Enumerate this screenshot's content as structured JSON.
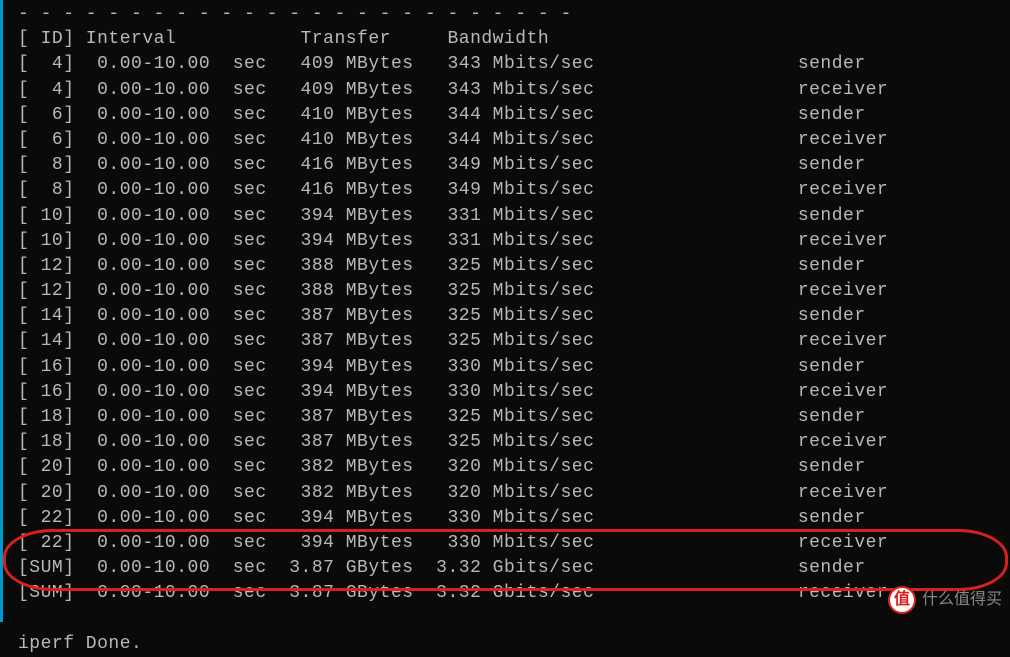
{
  "header": {
    "dashes": "- - - - - - - - - - - - - - - - - - - - - - - - -",
    "columns": "[ ID] Interval           Transfer     Bandwidth"
  },
  "rows": [
    {
      "id": "  4",
      "interval": "0.00-10.00",
      "unit": "sec",
      "transfer": " 409 MBytes",
      "bandwidth": " 343 Mbits/sec",
      "role": "sender"
    },
    {
      "id": "  4",
      "interval": "0.00-10.00",
      "unit": "sec",
      "transfer": " 409 MBytes",
      "bandwidth": " 343 Mbits/sec",
      "role": "receiver"
    },
    {
      "id": "  6",
      "interval": "0.00-10.00",
      "unit": "sec",
      "transfer": " 410 MBytes",
      "bandwidth": " 344 Mbits/sec",
      "role": "sender"
    },
    {
      "id": "  6",
      "interval": "0.00-10.00",
      "unit": "sec",
      "transfer": " 410 MBytes",
      "bandwidth": " 344 Mbits/sec",
      "role": "receiver"
    },
    {
      "id": "  8",
      "interval": "0.00-10.00",
      "unit": "sec",
      "transfer": " 416 MBytes",
      "bandwidth": " 349 Mbits/sec",
      "role": "sender"
    },
    {
      "id": "  8",
      "interval": "0.00-10.00",
      "unit": "sec",
      "transfer": " 416 MBytes",
      "bandwidth": " 349 Mbits/sec",
      "role": "receiver"
    },
    {
      "id": " 10",
      "interval": "0.00-10.00",
      "unit": "sec",
      "transfer": " 394 MBytes",
      "bandwidth": " 331 Mbits/sec",
      "role": "sender"
    },
    {
      "id": " 10",
      "interval": "0.00-10.00",
      "unit": "sec",
      "transfer": " 394 MBytes",
      "bandwidth": " 331 Mbits/sec",
      "role": "receiver"
    },
    {
      "id": " 12",
      "interval": "0.00-10.00",
      "unit": "sec",
      "transfer": " 388 MBytes",
      "bandwidth": " 325 Mbits/sec",
      "role": "sender"
    },
    {
      "id": " 12",
      "interval": "0.00-10.00",
      "unit": "sec",
      "transfer": " 388 MBytes",
      "bandwidth": " 325 Mbits/sec",
      "role": "receiver"
    },
    {
      "id": " 14",
      "interval": "0.00-10.00",
      "unit": "sec",
      "transfer": " 387 MBytes",
      "bandwidth": " 325 Mbits/sec",
      "role": "sender"
    },
    {
      "id": " 14",
      "interval": "0.00-10.00",
      "unit": "sec",
      "transfer": " 387 MBytes",
      "bandwidth": " 325 Mbits/sec",
      "role": "receiver"
    },
    {
      "id": " 16",
      "interval": "0.00-10.00",
      "unit": "sec",
      "transfer": " 394 MBytes",
      "bandwidth": " 330 Mbits/sec",
      "role": "sender"
    },
    {
      "id": " 16",
      "interval": "0.00-10.00",
      "unit": "sec",
      "transfer": " 394 MBytes",
      "bandwidth": " 330 Mbits/sec",
      "role": "receiver"
    },
    {
      "id": " 18",
      "interval": "0.00-10.00",
      "unit": "sec",
      "transfer": " 387 MBytes",
      "bandwidth": " 325 Mbits/sec",
      "role": "sender"
    },
    {
      "id": " 18",
      "interval": "0.00-10.00",
      "unit": "sec",
      "transfer": " 387 MBytes",
      "bandwidth": " 325 Mbits/sec",
      "role": "receiver"
    },
    {
      "id": " 20",
      "interval": "0.00-10.00",
      "unit": "sec",
      "transfer": " 382 MBytes",
      "bandwidth": " 320 Mbits/sec",
      "role": "sender"
    },
    {
      "id": " 20",
      "interval": "0.00-10.00",
      "unit": "sec",
      "transfer": " 382 MBytes",
      "bandwidth": " 320 Mbits/sec",
      "role": "receiver"
    },
    {
      "id": " 22",
      "interval": "0.00-10.00",
      "unit": "sec",
      "transfer": " 394 MBytes",
      "bandwidth": " 330 Mbits/sec",
      "role": "sender"
    },
    {
      "id": " 22",
      "interval": "0.00-10.00",
      "unit": "sec",
      "transfer": " 394 MBytes",
      "bandwidth": " 330 Mbits/sec",
      "role": "receiver"
    },
    {
      "id": "SUM",
      "interval": "0.00-10.00",
      "unit": "sec",
      "transfer": "3.87 GBytes",
      "bandwidth": "3.32 Gbits/sec",
      "role": "sender"
    },
    {
      "id": "SUM",
      "interval": "0.00-10.00",
      "unit": "sec",
      "transfer": "3.87 GBytes",
      "bandwidth": "3.32 Gbits/sec",
      "role": "receiver"
    }
  ],
  "footer": {
    "done": "iperf Done."
  },
  "watermark": {
    "badge": "值",
    "text": "什么值得买"
  }
}
